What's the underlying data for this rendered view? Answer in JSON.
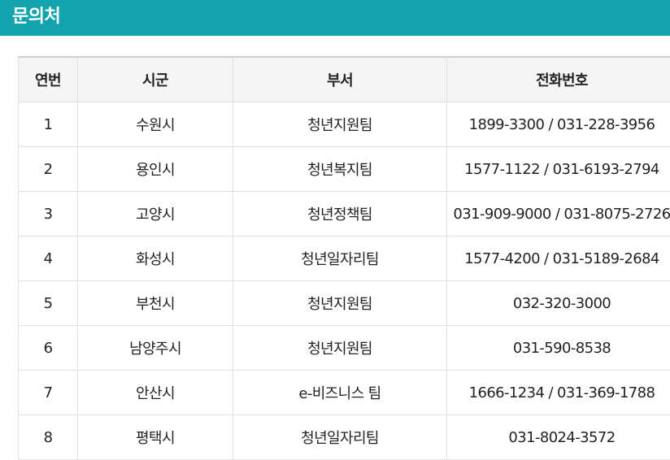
{
  "header": {
    "title": "문의처"
  },
  "table": {
    "columns": [
      "연번",
      "시군",
      "부서",
      "전화번호"
    ],
    "rows": [
      {
        "no": "1",
        "city": "수원시",
        "dept": "청년지원팀",
        "phone": "1899-3300 / 031-228-3956"
      },
      {
        "no": "2",
        "city": "용인시",
        "dept": "청년복지팀",
        "phone": "1577-1122 / 031-6193-2794"
      },
      {
        "no": "3",
        "city": "고양시",
        "dept": "청년정책팀",
        "phone": "031-909-9000 / 031-8075-2726"
      },
      {
        "no": "4",
        "city": "화성시",
        "dept": "청년일자리팀",
        "phone": "1577-4200 / 031-5189-2684"
      },
      {
        "no": "5",
        "city": "부천시",
        "dept": "청년지원팀",
        "phone": "032-320-3000"
      },
      {
        "no": "6",
        "city": "남양주시",
        "dept": "청년지원팀",
        "phone": "031-590-8538"
      },
      {
        "no": "7",
        "city": "안산시",
        "dept": "e-비즈니스 팀",
        "phone": "1666-1234 / 031-369-1788"
      },
      {
        "no": "8",
        "city": "평택시",
        "dept": "청년일자리팀",
        "phone": "031-8024-3572"
      }
    ]
  }
}
